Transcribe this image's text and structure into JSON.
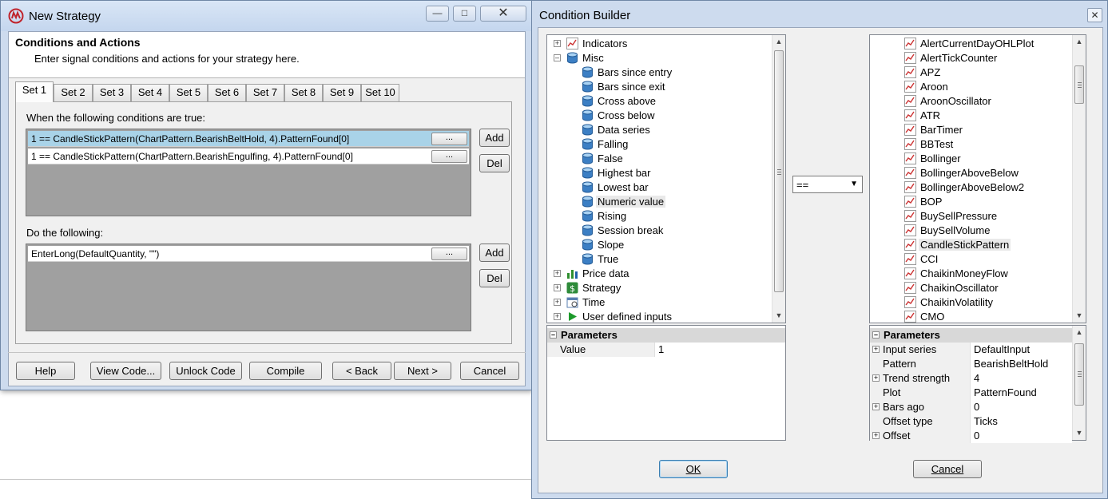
{
  "new_strategy": {
    "title": "New Strategy",
    "header_title": "Conditions and Actions",
    "header_subtitle": "Enter signal conditions and actions for your strategy here.",
    "tabs": [
      "Set 1",
      "Set 2",
      "Set 3",
      "Set 4",
      "Set 5",
      "Set 6",
      "Set 7",
      "Set 8",
      "Set 9",
      "Set 10"
    ],
    "active_tab": "Set 1",
    "conditions_label": "When the following conditions are true:",
    "conditions": [
      "1 == CandleStickPattern(ChartPattern.BearishBeltHold, 4).PatternFound[0]",
      "1 == CandleStickPattern(ChartPattern.BearishEngulfing, 4).PatternFound[0]"
    ],
    "actions_label": "Do the following:",
    "actions": [
      "EnterLong(DefaultQuantity, \"\")"
    ],
    "ellipsis": "...",
    "add_label": "Add",
    "del_label": "Del",
    "buttons": {
      "help": "Help",
      "view_code": "View Code...",
      "unlock_code": "Unlock Code",
      "compile": "Compile",
      "back": "< Back",
      "next": "Next >",
      "cancel": "Cancel"
    }
  },
  "condition_builder": {
    "title": "Condition Builder",
    "left_tree": [
      {
        "label": "Indicators",
        "level": 0,
        "expander": "+",
        "icon": "chart-icon"
      },
      {
        "label": "Misc",
        "level": 0,
        "expander": "-",
        "icon": "database-icon"
      },
      {
        "label": "Bars since entry",
        "level": 1,
        "icon": "database-icon"
      },
      {
        "label": "Bars since exit",
        "level": 1,
        "icon": "database-icon"
      },
      {
        "label": "Cross above",
        "level": 1,
        "icon": "database-icon"
      },
      {
        "label": "Cross below",
        "level": 1,
        "icon": "database-icon"
      },
      {
        "label": "Data series",
        "level": 1,
        "icon": "database-icon"
      },
      {
        "label": "Falling",
        "level": 1,
        "icon": "database-icon"
      },
      {
        "label": "False",
        "level": 1,
        "icon": "database-icon"
      },
      {
        "label": "Highest bar",
        "level": 1,
        "icon": "database-icon"
      },
      {
        "label": "Lowest bar",
        "level": 1,
        "icon": "database-icon"
      },
      {
        "label": "Numeric value",
        "level": 1,
        "icon": "database-icon",
        "selected": true
      },
      {
        "label": "Rising",
        "level": 1,
        "icon": "database-icon"
      },
      {
        "label": "Session break",
        "level": 1,
        "icon": "database-icon"
      },
      {
        "label": "Slope",
        "level": 1,
        "icon": "database-icon"
      },
      {
        "label": "True",
        "level": 1,
        "icon": "database-icon"
      },
      {
        "label": "Price data",
        "level": 0,
        "expander": "+",
        "icon": "bar-chart-icon"
      },
      {
        "label": "Strategy",
        "level": 0,
        "expander": "+",
        "icon": "dollar-icon"
      },
      {
        "label": "Time",
        "level": 0,
        "expander": "+",
        "icon": "calendar-icon"
      },
      {
        "label": "User defined inputs",
        "level": 0,
        "expander": "+",
        "icon": "play-icon"
      }
    ],
    "left_params_header": "Parameters",
    "left_params": [
      {
        "name": "Value",
        "value": "1"
      }
    ],
    "operator": "==",
    "right_list": [
      "AlertCurrentDayOHLPlot",
      "AlertTickCounter",
      "APZ",
      "Aroon",
      "AroonOscillator",
      "ATR",
      "BarTimer",
      "BBTest",
      "Bollinger",
      "BollingerAboveBelow",
      "BollingerAboveBelow2",
      "BOP",
      "BuySellPressure",
      "BuySellVolume",
      "CandleStickPattern",
      "CCI",
      "ChaikinMoneyFlow",
      "ChaikinOscillator",
      "ChaikinVolatility",
      "CMO"
    ],
    "right_selected": "CandleStickPattern",
    "right_params_header": "Parameters",
    "right_params": [
      {
        "name": "Input series",
        "value": "DefaultInput",
        "expander": "+"
      },
      {
        "name": "Pattern",
        "value": "BearishBeltHold"
      },
      {
        "name": "Trend strength",
        "value": "4",
        "expander": "+"
      },
      {
        "name": "Plot",
        "value": "PatternFound"
      },
      {
        "name": "Bars ago",
        "value": "0",
        "expander": "+"
      },
      {
        "name": "Offset type",
        "value": "Ticks"
      },
      {
        "name": "Offset",
        "value": "0",
        "expander": "+"
      }
    ],
    "ok_label": "OK",
    "cancel_label": "Cancel"
  }
}
